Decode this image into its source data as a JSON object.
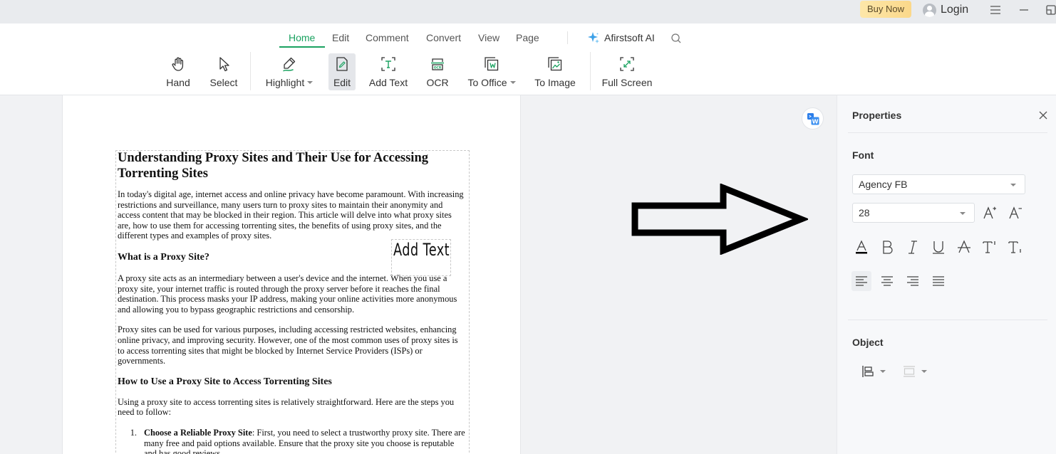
{
  "titlebar": {
    "buy_now": "Buy Now",
    "login": "Login"
  },
  "ribbon": {
    "tabs": [
      {
        "label": "Home",
        "active": true
      },
      {
        "label": "Edit"
      },
      {
        "label": "Comment"
      },
      {
        "label": "Convert"
      },
      {
        "label": "View"
      },
      {
        "label": "Page"
      }
    ],
    "ai_label": "Afirstsoft AI",
    "tools": [
      {
        "label": "Hand",
        "icon": "hand-icon"
      },
      {
        "label": "Select",
        "icon": "cursor-icon"
      },
      {
        "label": "Highlight",
        "icon": "highlight-pen-icon",
        "dropdown": true
      },
      {
        "label": "Edit",
        "icon": "edit-document-icon",
        "active": true
      },
      {
        "label": "Add Text",
        "icon": "add-text-icon"
      },
      {
        "label": "OCR",
        "icon": "ocr-icon"
      },
      {
        "label": "To Office",
        "icon": "to-office-icon",
        "dropdown": true
      },
      {
        "label": "To Image",
        "icon": "to-image-icon"
      },
      {
        "label": "Full Screen",
        "icon": "full-screen-icon"
      }
    ],
    "accent_color": "#1aa260"
  },
  "document": {
    "title": "Understanding Proxy Sites and Their Use for Accessing Torrenting Sites",
    "intro": "In today's digital age, internet access and online privacy have become paramount. With increasing restrictions and surveillance, many users turn to proxy sites to maintain their anonymity and access content that may be blocked in their region. This article will delve into what proxy sites are, how to use them for accessing torrenting sites, the benefits of using proxy sites, and the different types and examples of proxy sites.",
    "h2_what": "What is a Proxy Site?",
    "p_what_1": "A proxy site acts as an intermediary between a user's device and the internet. When you use a proxy site, your internet traffic is routed through the proxy server before it reaches the final destination. This process masks your IP address, making your online activities more anonymous and allowing you to bypass geographic restrictions and censorship.",
    "p_what_2": "Proxy sites can be used for various purposes, including accessing restricted websites, enhancing online privacy, and improving security. However, one of the most common uses of proxy sites is to access torrenting sites that might be blocked by Internet Service Providers (ISPs) or governments.",
    "h2_how": "How to Use a Proxy Site to Access Torrenting Sites",
    "p_how": "Using a proxy site to access torrenting sites is relatively straightforward. Here are the steps you need to follow:",
    "steps": [
      {
        "num": "1.",
        "bold": "Choose a Reliable Proxy Site",
        "text": ": First, you need to select a trustworthy proxy site. There are many free and paid options available. Ensure that the proxy site you choose is reputable and has good reviews."
      }
    ],
    "added_text": "Add Text"
  },
  "properties": {
    "title": "Properties",
    "font_section": "Font",
    "font_family": "Agency FB",
    "font_size": "28",
    "object_section": "Object",
    "text_align": "left"
  }
}
